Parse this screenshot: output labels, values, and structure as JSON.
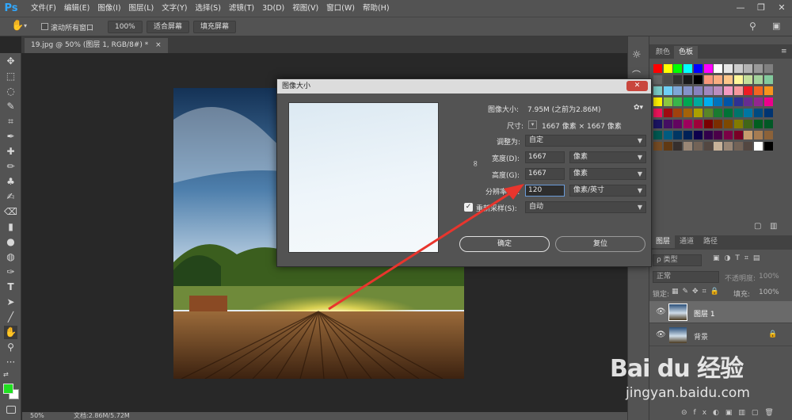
{
  "app": {
    "logo": "Ps"
  },
  "menu": [
    "文件(F)",
    "编辑(E)",
    "图像(I)",
    "图层(L)",
    "文字(Y)",
    "选择(S)",
    "滤镜(T)",
    "3D(D)",
    "视图(V)",
    "窗口(W)",
    "帮助(H)"
  ],
  "window_controls": {
    "minimize": "—",
    "restore": "❐",
    "close": "✕"
  },
  "options": {
    "scroll_all": "滚动所有窗口",
    "zoom": "100%",
    "fit_screen": "适合屏幕",
    "fill_screen": "填充屏幕"
  },
  "document": {
    "tab": "19.jpg @ 50% (图层 1, RGB/8#) *",
    "tab_close": "×"
  },
  "status": {
    "zoom": "50%",
    "doc": "文档:2.86M/5.72M"
  },
  "panels": {
    "tabs": [
      "颜色",
      "色板"
    ],
    "layers_tabs": [
      "图层",
      "通道",
      "路径"
    ],
    "kind": "ρ 类型",
    "blend": "正常",
    "opacity_label": "不透明度:",
    "opacity": "100%",
    "lock_label": "锁定:",
    "fill_label": "填充:",
    "fill": "100%",
    "layers": [
      {
        "name": "图层 1",
        "selected": true
      },
      {
        "name": "背景",
        "locked": true
      }
    ]
  },
  "swatch_colors": [
    [
      "#ff0000",
      "#ffff00",
      "#00ff00",
      "#00ffff",
      "#0000ff",
      "#ff00ff",
      "#ffffff",
      "#e6e6e6",
      "#cccccc",
      "#b3b3b3",
      "#999999",
      "#808080"
    ],
    [
      "#666666",
      "#4d4d4d",
      "#333333",
      "#1a1a1a",
      "#000000",
      "#f7977a",
      "#f9ad81",
      "#fdc68a",
      "#fff79a",
      "#c4df9b",
      "#a3d39c",
      "#82ca9d"
    ],
    [
      "#7bcdc8",
      "#6ecff6",
      "#7ea7d8",
      "#8493ca",
      "#8882be",
      "#a187be",
      "#bc8dbf",
      "#f49ac2",
      "#f6989d",
      "#ed1c24",
      "#f26522",
      "#f7941d"
    ],
    [
      "#fff200",
      "#8dc63f",
      "#39b54a",
      "#00a651",
      "#00a99d",
      "#00aeef",
      "#0072bc",
      "#0054a6",
      "#2e3192",
      "#662d91",
      "#92278f",
      "#ec008c"
    ],
    [
      "#ed145b",
      "#9e0b0f",
      "#a0410d",
      "#a3620a",
      "#aba000",
      "#598527",
      "#197b30",
      "#007236",
      "#00746b",
      "#0076a3",
      "#004a80",
      "#003471"
    ],
    [
      "#1b1464",
      "#440e62",
      "#630460",
      "#9e005d",
      "#9e0039",
      "#790000",
      "#7b2e00",
      "#7d4900",
      "#827b00",
      "#406618",
      "#005e20",
      "#005826"
    ],
    [
      "#005952",
      "#005b7f",
      "#003663",
      "#002157",
      "#0d004c",
      "#32004b",
      "#4b0049",
      "#7b0046",
      "#7a0026",
      "#c69c6d",
      "#a67c52",
      "#8c6239"
    ],
    [
      "#754c24",
      "#603913",
      "#362f2d",
      "#998675",
      "#736357",
      "#534741",
      "#c7b299",
      "#998675",
      "#736357",
      "#534741",
      "#ffffff",
      "#000000"
    ]
  ],
  "dialog": {
    "title": "图像大小",
    "close": "✕",
    "size_label": "图像大小:",
    "size_value": "7.95M (之前为2.86M)",
    "gear": "✿▾",
    "dims_label": "尺寸:",
    "dims_value": "1667 像素 × 1667 像素",
    "fit_label": "调整为:",
    "fit_value": "自定",
    "width_label": "宽度(D):",
    "width_value": "1667",
    "width_unit": "像素",
    "height_label": "高度(G):",
    "height_value": "1667",
    "height_unit": "像素",
    "res_label": "分辨率(R):",
    "res_value": "120",
    "res_unit": "像素/英寸",
    "resample_label": "重新采样(S):",
    "resample_value": "自动",
    "resample_checked": true,
    "ok": "确定",
    "reset": "复位"
  },
  "watermark": {
    "logo": "Bai du 经验",
    "url": "jingyan.baidu.com"
  }
}
